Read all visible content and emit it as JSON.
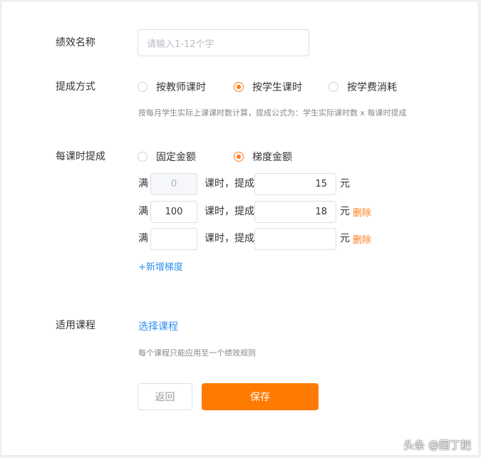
{
  "form": {
    "name_label": "绩效名称",
    "name_placeholder": "请输入1-12个字",
    "mode_label": "提成方式",
    "mode_options": [
      "按教师课时",
      "按学生课时",
      "按学费消耗"
    ],
    "mode_selected": "按学生课时",
    "mode_hint": "按每月学生实际上课课时数计算，提成公式为：学生实际课时数 x 每课时提成",
    "per_label": "每课时提成",
    "per_options": [
      "固定金额",
      "梯度金额"
    ],
    "per_selected": "梯度金额",
    "tiers": [
      {
        "prefix": "满",
        "hours": "0",
        "mid": "课时，提成",
        "amount": "15",
        "unit": "元",
        "delete": ""
      },
      {
        "prefix": "满",
        "hours": "100",
        "mid": "课时，提成",
        "amount": "18",
        "unit": "元",
        "delete": "删除"
      },
      {
        "prefix": "满",
        "hours": "",
        "mid": "课时，提成",
        "amount": "",
        "unit": "元",
        "delete": "删除"
      }
    ],
    "add_tier": "+新增梯度",
    "course_label": "适用课程",
    "course_link": "选择课程",
    "course_hint": "每个课程只能应用至一个绩效规则"
  },
  "buttons": {
    "back": "返回",
    "save": "保存"
  },
  "watermark": "头条 @园丁耙",
  "colors": {
    "accent": "#ff7a00",
    "link": "#2f8ff0"
  }
}
